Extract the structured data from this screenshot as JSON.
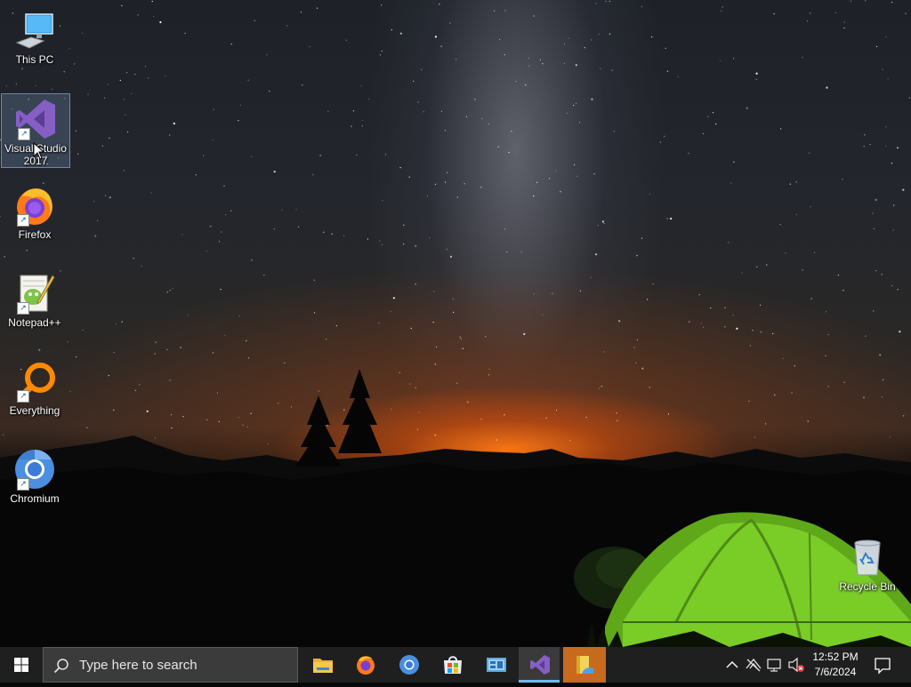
{
  "desktop": {
    "icons": [
      {
        "id": "this-pc",
        "label": "This PC"
      },
      {
        "id": "visual-studio",
        "label": "Visual Studio 2017",
        "line1": "Visual Studio",
        "line2": "2017"
      },
      {
        "id": "firefox",
        "label": "Firefox"
      },
      {
        "id": "notepadpp",
        "label": "Notepad++"
      },
      {
        "id": "everything",
        "label": "Everything"
      },
      {
        "id": "chromium",
        "label": "Chromium"
      },
      {
        "id": "recycle-bin",
        "label": "Recycle Bin"
      }
    ],
    "selected_icon": "Visual Studio 2017"
  },
  "taskbar": {
    "search_placeholder": "Type here to search",
    "pinned_apps": [
      {
        "name": "File Explorer",
        "icon": "folder-icon"
      },
      {
        "name": "Firefox",
        "icon": "firefox-icon"
      },
      {
        "name": "Chromium",
        "icon": "chromium-icon"
      },
      {
        "name": "Microsoft Store",
        "icon": "store-icon"
      },
      {
        "name": "Control Panel",
        "icon": "control-panel-icon"
      },
      {
        "name": "Visual Studio",
        "icon": "visual-studio-icon",
        "state": "active"
      },
      {
        "name": "Sticky app",
        "icon": "document-icon",
        "state": "highlighted"
      }
    ],
    "tray": {
      "icons": [
        "chevron-up-icon",
        "network-disconnected-icon",
        "display-icon",
        "volume-muted-icon"
      ],
      "time": "12:52 PM",
      "date": "7/6/2024"
    }
  },
  "colors": {
    "taskbar_bg": "#1f1f1f",
    "search_bg": "#3b3b3b",
    "active_indicator": "#76b9ed",
    "highlight_app": "#c86a1e",
    "vs_purple": "#865fc5"
  }
}
